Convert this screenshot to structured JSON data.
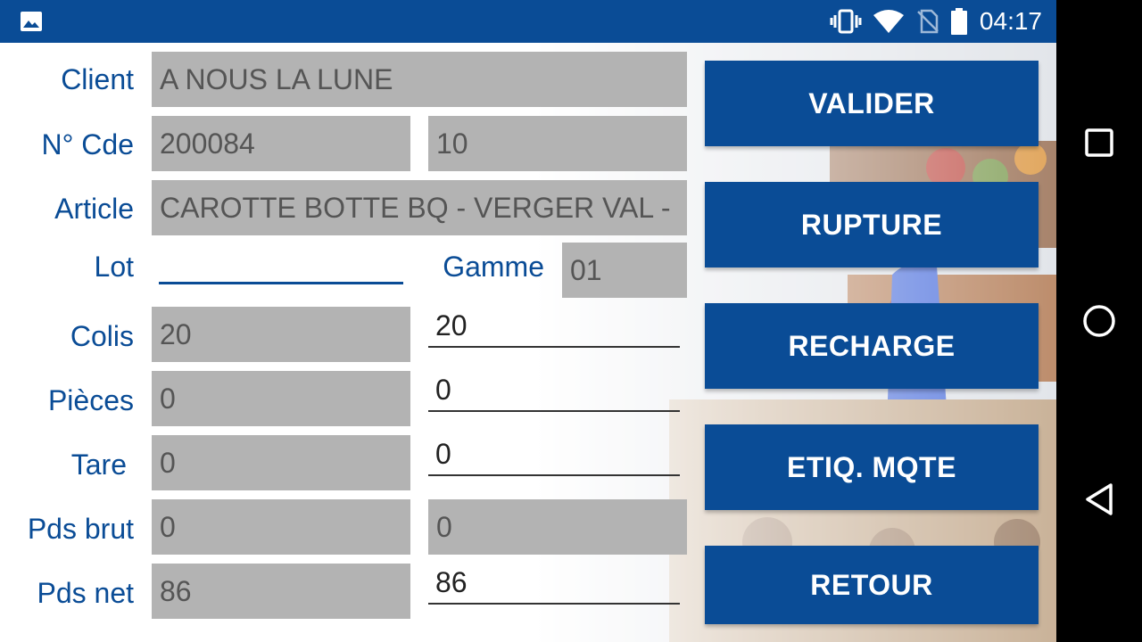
{
  "status_bar": {
    "time": "04:17",
    "icons": [
      "image-icon",
      "vibrate-icon",
      "wifi-icon",
      "no-sim-icon",
      "battery-icon"
    ]
  },
  "form": {
    "client_label": "Client",
    "client_value": "A NOUS LA LUNE",
    "cde_label": "N° Cde",
    "cde_value": "200084",
    "cde_line_value": "10",
    "article_label": "Article",
    "article_value": "CAROTTE BOTTE BQ - VERGER VAL -",
    "lot_label": "Lot",
    "lot_value": "",
    "gamme_label": "Gamme",
    "gamme_value": "01",
    "colis_label": "Colis",
    "colis_value": "20",
    "colis_input": "20",
    "pieces_label": "Pièces",
    "pieces_value": "0",
    "pieces_input": "0",
    "tare_label": "Tare",
    "tare_value": "0",
    "tare_input": "0",
    "pds_brut_label": "Pds brut",
    "pds_brut_value": "0",
    "pds_brut_value2": "0",
    "pds_net_label": "Pds net",
    "pds_net_value": "86",
    "pds_net_input": "86"
  },
  "buttons": {
    "valider": "VALIDER",
    "rupture": "RUPTURE",
    "recharge": "RECHARGE",
    "etiq": "ETIQ. MQTE",
    "retour": "RETOUR"
  },
  "colors": {
    "primary": "#0a4c96",
    "field_bg": "#b3b3b3",
    "navbar": "#000000"
  },
  "nav_bar": {
    "icons": [
      "recents-square-icon",
      "home-circle-icon",
      "back-triangle-icon"
    ]
  }
}
